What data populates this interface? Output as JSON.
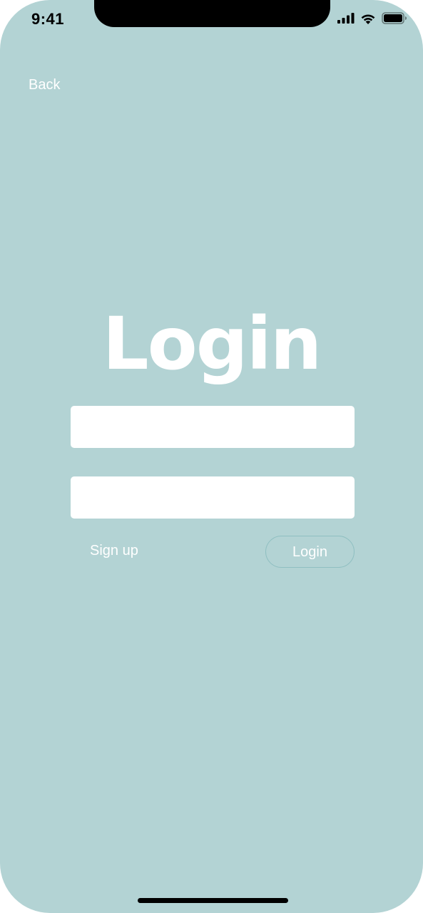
{
  "status_bar": {
    "time": "9:41",
    "icons": [
      "cellular-signal-icon",
      "wifi-icon",
      "battery-icon"
    ]
  },
  "nav": {
    "back_label": "Back"
  },
  "title": "Login",
  "form": {
    "username": {
      "value": "",
      "placeholder": ""
    },
    "password": {
      "value": "",
      "placeholder": ""
    }
  },
  "actions": {
    "signup_label": "Sign up",
    "login_label": "Login"
  },
  "colors": {
    "background": "#b3d3d4",
    "foreground": "#ffffff",
    "button_border": "#8fbfc1"
  }
}
